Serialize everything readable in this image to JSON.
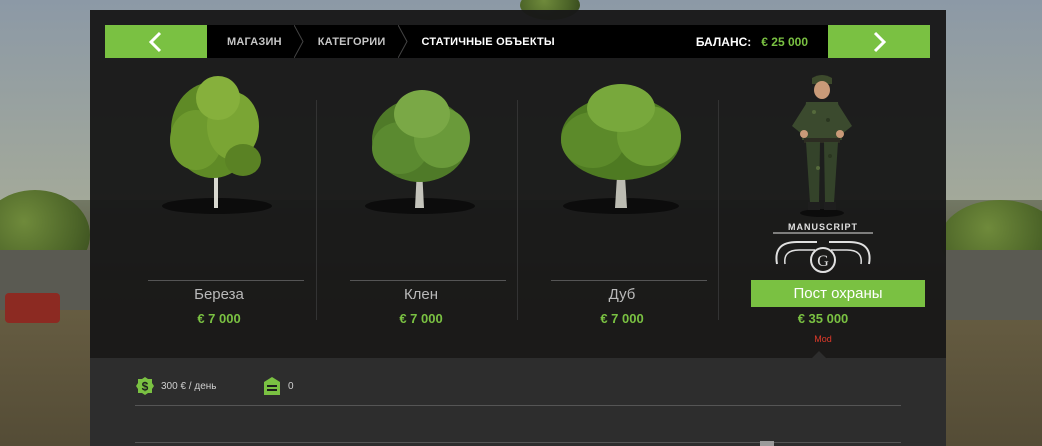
{
  "breadcrumbs": [
    {
      "label": "МАГАЗИН"
    },
    {
      "label": "КАТЕГОРИИ"
    },
    {
      "label": "СТАТИЧНЫЕ ОБЪЕКТЫ"
    }
  ],
  "balance": {
    "label": "БАЛАНС:",
    "value": "€ 25 000"
  },
  "items": [
    {
      "name": "Береза",
      "price": "€ 7 000",
      "icon": "birch-tree-image"
    },
    {
      "name": "Клен",
      "price": "€ 7 000",
      "icon": "maple-tree-image"
    },
    {
      "name": "Дуб",
      "price": "€ 7 000",
      "icon": "oak-tree-image"
    },
    {
      "name": "Пост охраны",
      "price": "€ 35 000",
      "badge": "Mod",
      "icon": "guard-post-image",
      "logo_text": "MANUSCRIPT",
      "selected": true
    }
  ],
  "details": {
    "upkeep": "300 € / день",
    "capacity": "0"
  },
  "colors": {
    "accent": "#7ac142",
    "mod": "#e23a2a"
  }
}
